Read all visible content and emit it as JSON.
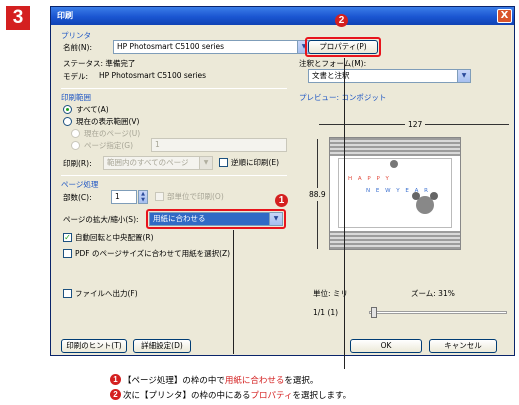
{
  "step_number": "3",
  "dialog": {
    "title": "印刷",
    "close_label": "X"
  },
  "printer": {
    "group_label": "プリンタ",
    "name_label": "名前(N):",
    "name_value": "HP Photosmart C5100 series",
    "status_label": "ステータス: 準備完了",
    "model_label": "モデル:",
    "model_value": "HP Photosmart C5100 series",
    "properties_button": "プロパティ(P)",
    "annotation_label": "注釈とフォーム(M):",
    "annotation_value": "文書と注釈"
  },
  "print_range": {
    "group_label": "印刷範囲",
    "all": "すべて(A)",
    "current_view": "現在の表示範囲(V)",
    "current_page": "現在のページ(U)",
    "pages": "ページ指定(G)",
    "pages_value": "1",
    "print_label": "印刷(R):",
    "print_value": "範囲内のすべてのページ",
    "reverse_pages": "逆順に印刷(E)"
  },
  "page_handling": {
    "group_label": "ページ処理",
    "copies_label": "部数(C):",
    "copies_value": "1",
    "collate": "部単位で印刷(O)",
    "scaling_label": "ページの拡大/縮小(S):",
    "scaling_value": "用紙に合わせる",
    "auto_rotate": "自動回転と中央配置(R)",
    "pdf_page_size": "PDF のページサイズに合わせて用紙を選択(Z)"
  },
  "print_to_file": "ファイルへ出力(F)",
  "preview": {
    "group_label": "プレビュー: コンポジット",
    "width_value": "127",
    "height_value": "88.9",
    "card_text_top": "H A P P Y",
    "card_text_bottom": "N E W   Y E A R",
    "unit_label": "単位: ミリ",
    "zoom_label": "ズーム: 31%",
    "page_indicator": "1/1 (1)"
  },
  "buttons": {
    "hint": "印刷のヒント(T)",
    "advanced": "詳細設定(D)",
    "ok": "OK",
    "cancel": "キャンセル"
  },
  "markers": {
    "one": "1",
    "two": "2"
  },
  "captions": {
    "line1_bullet": "1",
    "line1_pre": "【ページ処理】の枠の中で",
    "line1_highlight": "用紙に合わせる",
    "line1_post": "を選択。",
    "line2_bullet": "2",
    "line2_pre": "次に【プリンタ】の枠の中にある",
    "line2_highlight": "プロパティ",
    "line2_post": "を選択します。"
  },
  "colors": {
    "accent_red": "#d42020",
    "highlight_select": "#316ac5",
    "group_label_blue": "#1d55c4",
    "title_blue": "#1a55d1"
  }
}
